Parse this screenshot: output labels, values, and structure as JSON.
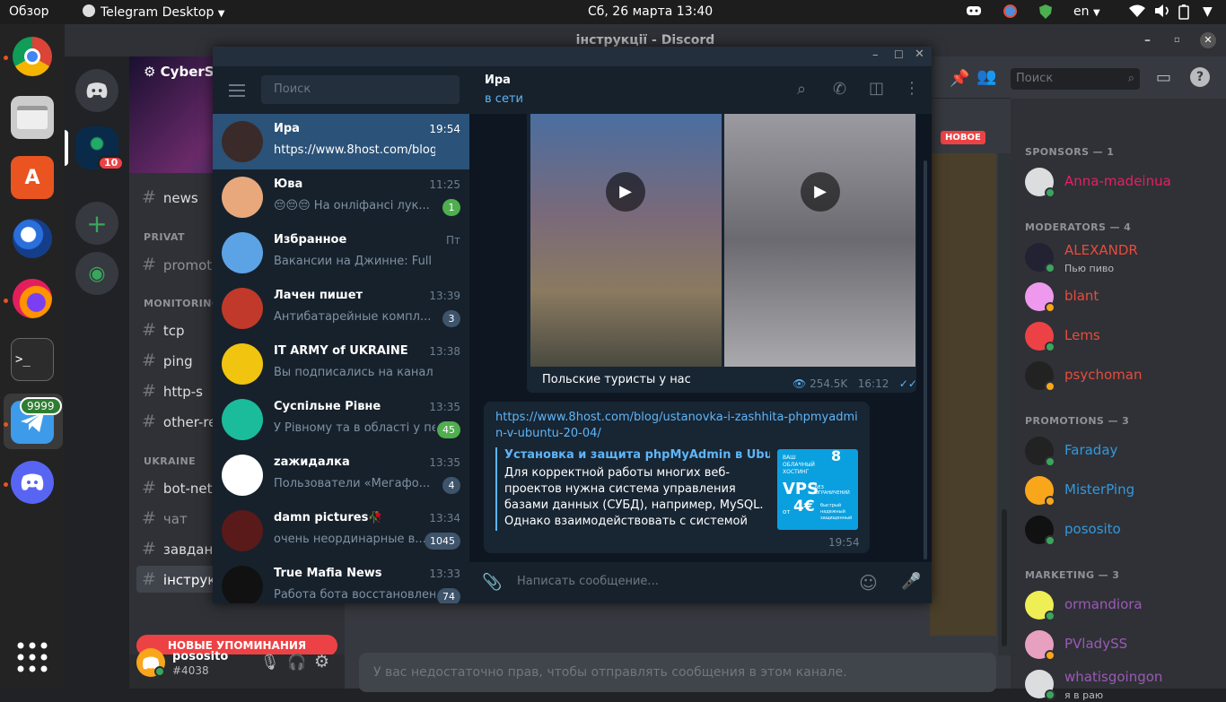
{
  "topbar": {
    "overview": "Обзор",
    "app": "Telegram Desktop",
    "clock": "Сб, 26 марта  13:40",
    "lang": "en"
  },
  "dock": {
    "telegram_badge": "9999"
  },
  "discord": {
    "title": "інструкції - Discord",
    "server_name": "CyberSp",
    "server_badge": "10",
    "channels": [
      {
        "name": "news"
      },
      {
        "name": "promoti"
      },
      {
        "name": "tcp"
      },
      {
        "name": "ping"
      },
      {
        "name": "http-s"
      },
      {
        "name": "other-re"
      },
      {
        "name": "bot-net"
      },
      {
        "name": "чат"
      },
      {
        "name": "завданн"
      },
      {
        "name": "інструк"
      }
    ],
    "categories": [
      "PRIVAT",
      "MONITORING",
      "UKRAINE"
    ],
    "new_mentions": "НОВЫЕ УПОМИНАНИЯ",
    "new_badge": "НОВОЕ",
    "search_placeholder": "Поиск",
    "no_permission": "У вас недостаточно прав, чтобы отправлять сообщения в этом канале.",
    "user": {
      "name": "pososito",
      "tag": "#4038"
    },
    "member_groups": [
      {
        "title": "SPONSORS — 1",
        "members": [
          {
            "name": "Anna-madeinua",
            "color": "#e91e63",
            "status": ""
          }
        ]
      },
      {
        "title": "MODERATORS — 4",
        "members": [
          {
            "name": "ALEXANDR",
            "color": "#e74c3c",
            "status": "Пью пиво"
          },
          {
            "name": "blant",
            "color": "#e74c3c",
            "status": ""
          },
          {
            "name": "Lems",
            "color": "#e74c3c",
            "status": ""
          },
          {
            "name": "psychoman",
            "color": "#e74c3c",
            "status": ""
          }
        ]
      },
      {
        "title": "PROMOTIONS — 3",
        "members": [
          {
            "name": "Faraday",
            "color": "#3498db",
            "status": ""
          },
          {
            "name": "MisterPing",
            "color": "#3498db",
            "status": ""
          },
          {
            "name": "pososito",
            "color": "#3498db",
            "status": ""
          }
        ]
      },
      {
        "title": "MARKETING — 3",
        "members": [
          {
            "name": "ormandiora",
            "color": "#9b59b6",
            "status": ""
          },
          {
            "name": "PVladySS",
            "color": "#9b59b6",
            "status": ""
          },
          {
            "name": "whatisgoingon",
            "color": "#9b59b6",
            "status": "я в раю"
          }
        ]
      }
    ]
  },
  "telegram": {
    "search_placeholder": "Поиск",
    "chats": [
      {
        "name": "Ира",
        "time": "19:54",
        "msg": "https://www.8host.com/blog...",
        "badge": "",
        "active": true,
        "avatar_color": "#3a2a2a"
      },
      {
        "name": "Юва",
        "time": "11:25",
        "msg": "😔😔😔 На онліфансі лук...",
        "badge": "1",
        "avatar_color": "#e8a87c"
      },
      {
        "name": "Избранное",
        "time": "Пт",
        "msg": "Вакансии на Джинне: Full S...",
        "badge": "",
        "avatar_color": "#5ca3e6"
      },
      {
        "name": "Лачен пишет",
        "time": "13:39",
        "msg": "Антибатарейные компл...",
        "badge": "3",
        "avatar_color": "#c0392b"
      },
      {
        "name": "IT ARMY of UKRAINE",
        "time": "13:38",
        "msg": "Вы подписались на канал",
        "badge": "",
        "avatar_color": "#f1c40f"
      },
      {
        "name": "Суспільне Рівне",
        "time": "13:35",
        "msg": "У Рівному та в області у пе...",
        "badge": "45",
        "avatar_color": "#1abc9c"
      },
      {
        "name": "zажидалка",
        "time": "13:35",
        "msg": "Пользователи «Мегафо...",
        "badge": "4",
        "avatar_color": "#ffffff"
      },
      {
        "name": "damn pictures🥀",
        "time": "13:34",
        "msg": "очень неординарные в...",
        "badge": "1045",
        "avatar_color": "#5a1a1a"
      },
      {
        "name": "True Mafia News",
        "time": "13:33",
        "msg": "Работа бота восстановлен...",
        "badge": "74",
        "avatar_color": "#111111"
      }
    ],
    "header": {
      "name": "Ира",
      "status": "в сети"
    },
    "media_caption": "Польские туристы у нас",
    "views": "254.5K",
    "media_time": "16:12",
    "link": "https://www.8host.com/blog/ustanovka-i-zashhita-phpmyadmin-v-ubuntu-20-04/",
    "preview_title": "Установка и защита phpMyAdmin в Ubuntu...",
    "preview_text": "Для корректной работы многих веб-проектов нужна система управления базами данных (СУБД), например, MySQL. Однако взаимодействовать с системой исключитель...",
    "preview_image": {
      "line1": "ВАШ",
      "line2": "ОБЛАЧНЫЙ",
      "line3": "ХОСТИНГ",
      "vps": "VPS",
      "unlim": "БЕЗ ОГРАНИЧЕНИЙ",
      "from": "от",
      "price": "4€",
      "b1": "быстрый",
      "b2": "надежный",
      "b3": "защищенный",
      "brand": "8"
    },
    "link_time": "19:54",
    "input_placeholder": "Написать сообщение..."
  },
  "colors": {
    "tg_active": "#2b5278",
    "tg_accent": "#5eb5f7",
    "discord_blurple": "#5865f2",
    "discord_red": "#ed4245"
  }
}
